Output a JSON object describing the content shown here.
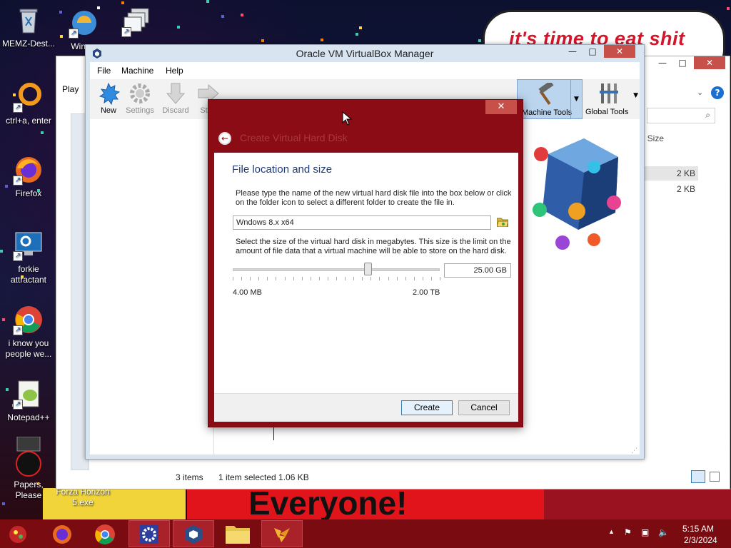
{
  "desktop": {
    "icons": [
      {
        "label": "MEMZ-Dest..."
      },
      {
        "label": "Wina..."
      },
      {
        "label": "ctrl+a, enter"
      },
      {
        "label": "Firefox"
      },
      {
        "label": "forkie attractant"
      },
      {
        "label": "i know you people we..."
      },
      {
        "label": "Notepad++"
      },
      {
        "label": "Papers, Please"
      },
      {
        "label": "Forza Horizon 5.exe"
      }
    ],
    "wallpaper_text_top": "it's time to eat shit",
    "wallpaper_text_bottom": "Everyone!"
  },
  "explorer": {
    "tab_label": "Play",
    "column_header": "Size",
    "sizes": [
      "2 KB",
      "2 KB"
    ],
    "status_items": "3 items",
    "status_selected": "1 item selected  1.06 KB",
    "help_icon": "?"
  },
  "vbox": {
    "title": "Oracle VM VirtualBox Manager",
    "menu": [
      "File",
      "Machine",
      "Help"
    ],
    "toolbar": {
      "new": "New",
      "settings": "Settings",
      "discard": "Discard",
      "start": "Start",
      "machine_tools": "Machine Tools",
      "global_tools": "Global Tools"
    },
    "window_buttons": {
      "minimize": "—",
      "maximize": "□",
      "close": "✕"
    }
  },
  "dialog": {
    "title": "Create Virtual Hard Disk",
    "close": "✕",
    "section_title": "File location and size",
    "location_text": "Please type the name of the new virtual hard disk file into the box below or click on the folder icon to select a different folder to create the file in.",
    "file_name": "Wndows 8.x x64",
    "size_text": "Select the size of the virtual hard disk in megabytes. This size is the limit on the amount of file data that a virtual machine will be able to store on the hard disk.",
    "size_value": "25.00 GB",
    "slider_fraction": 0.65,
    "min_label": "4.00 MB",
    "max_label": "2.00 TB",
    "create_button": "Create",
    "cancel_button": "Cancel"
  },
  "taskbar": {
    "time": "5:15 AM",
    "date": "2/3/2024",
    "colors": {
      "bar": "#7a0b10",
      "accent": "#a9222a"
    }
  }
}
